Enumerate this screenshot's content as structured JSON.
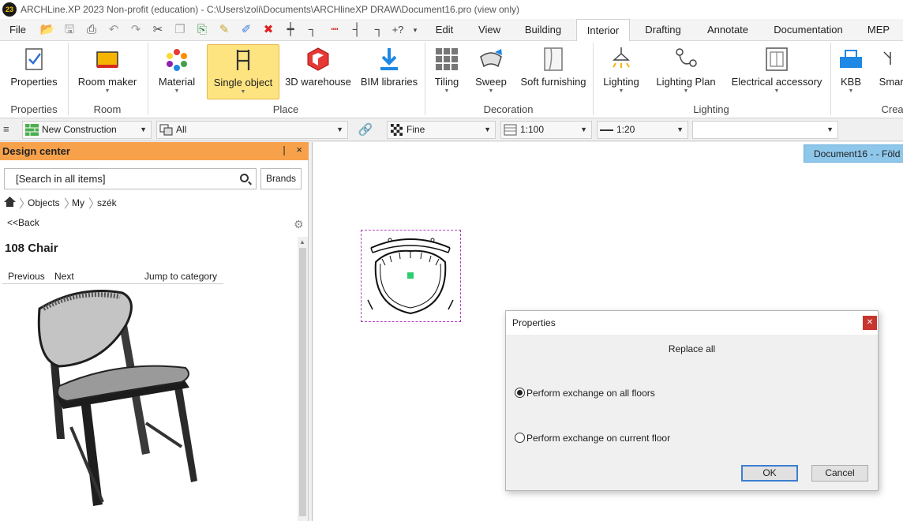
{
  "window": {
    "title": "ARCHLine.XP 2023 Non-profit (education) - C:\\Users\\zoli\\Documents\\ARCHlineXP DRAW\\Document16.pro (view only)",
    "logo": "23"
  },
  "menu": {
    "file": "File",
    "tabs": [
      "Edit",
      "View",
      "Building",
      "Interior",
      "Drafting",
      "Annotate",
      "Documentation",
      "MEP"
    ],
    "active_tab": "Interior"
  },
  "ribbon": {
    "buttons": {
      "properties": "Properties",
      "room_maker": "Room maker",
      "material": "Material",
      "single_object": "Single object",
      "warehouse": "3D warehouse",
      "bim": "BIM libraries",
      "tiling": "Tiling",
      "sweep": "Sweep",
      "soft": "Soft furnishing",
      "lighting": "Lighting",
      "lighting_plan": "Lighting Plan",
      "electrical": "Electrical accessory",
      "kbb": "KBB",
      "smart": "Smart"
    },
    "groups": {
      "properties": "Properties",
      "room": "Room",
      "place": "Place",
      "decoration": "Decoration",
      "lighting": "Lighting",
      "create": "Create"
    }
  },
  "layerbar": {
    "layer": "New Construction",
    "filter": "All",
    "quality": "Fine",
    "scale1": "1:100",
    "scale2": "1:20",
    "extra": ""
  },
  "design_center": {
    "title": "Design center",
    "pin": "❘",
    "close": "×",
    "search_placeholder": "[Search in all items]",
    "brands": "Brands",
    "breadcrumb": [
      "Objects",
      "My",
      "szék"
    ],
    "back": "<<Back",
    "item_title": "108 Chair",
    "nav": {
      "previous": "Previous",
      "next": "Next",
      "jump": "Jump to category"
    }
  },
  "canvas": {
    "doc_tab": "Document16 -  - Föld"
  },
  "dialog": {
    "title": "Properties",
    "subtitle": "Replace all",
    "option_all": "Perform exchange on all floors",
    "option_current": "Perform exchange on current floor",
    "selected": "all",
    "ok": "OK",
    "cancel": "Cancel"
  },
  "colors": {
    "accent": "#f7a24b",
    "selection": "#b13cc2",
    "active_button": "#fde480",
    "doc_tab": "#8ec7ea",
    "anchor": "#2ecc71"
  }
}
